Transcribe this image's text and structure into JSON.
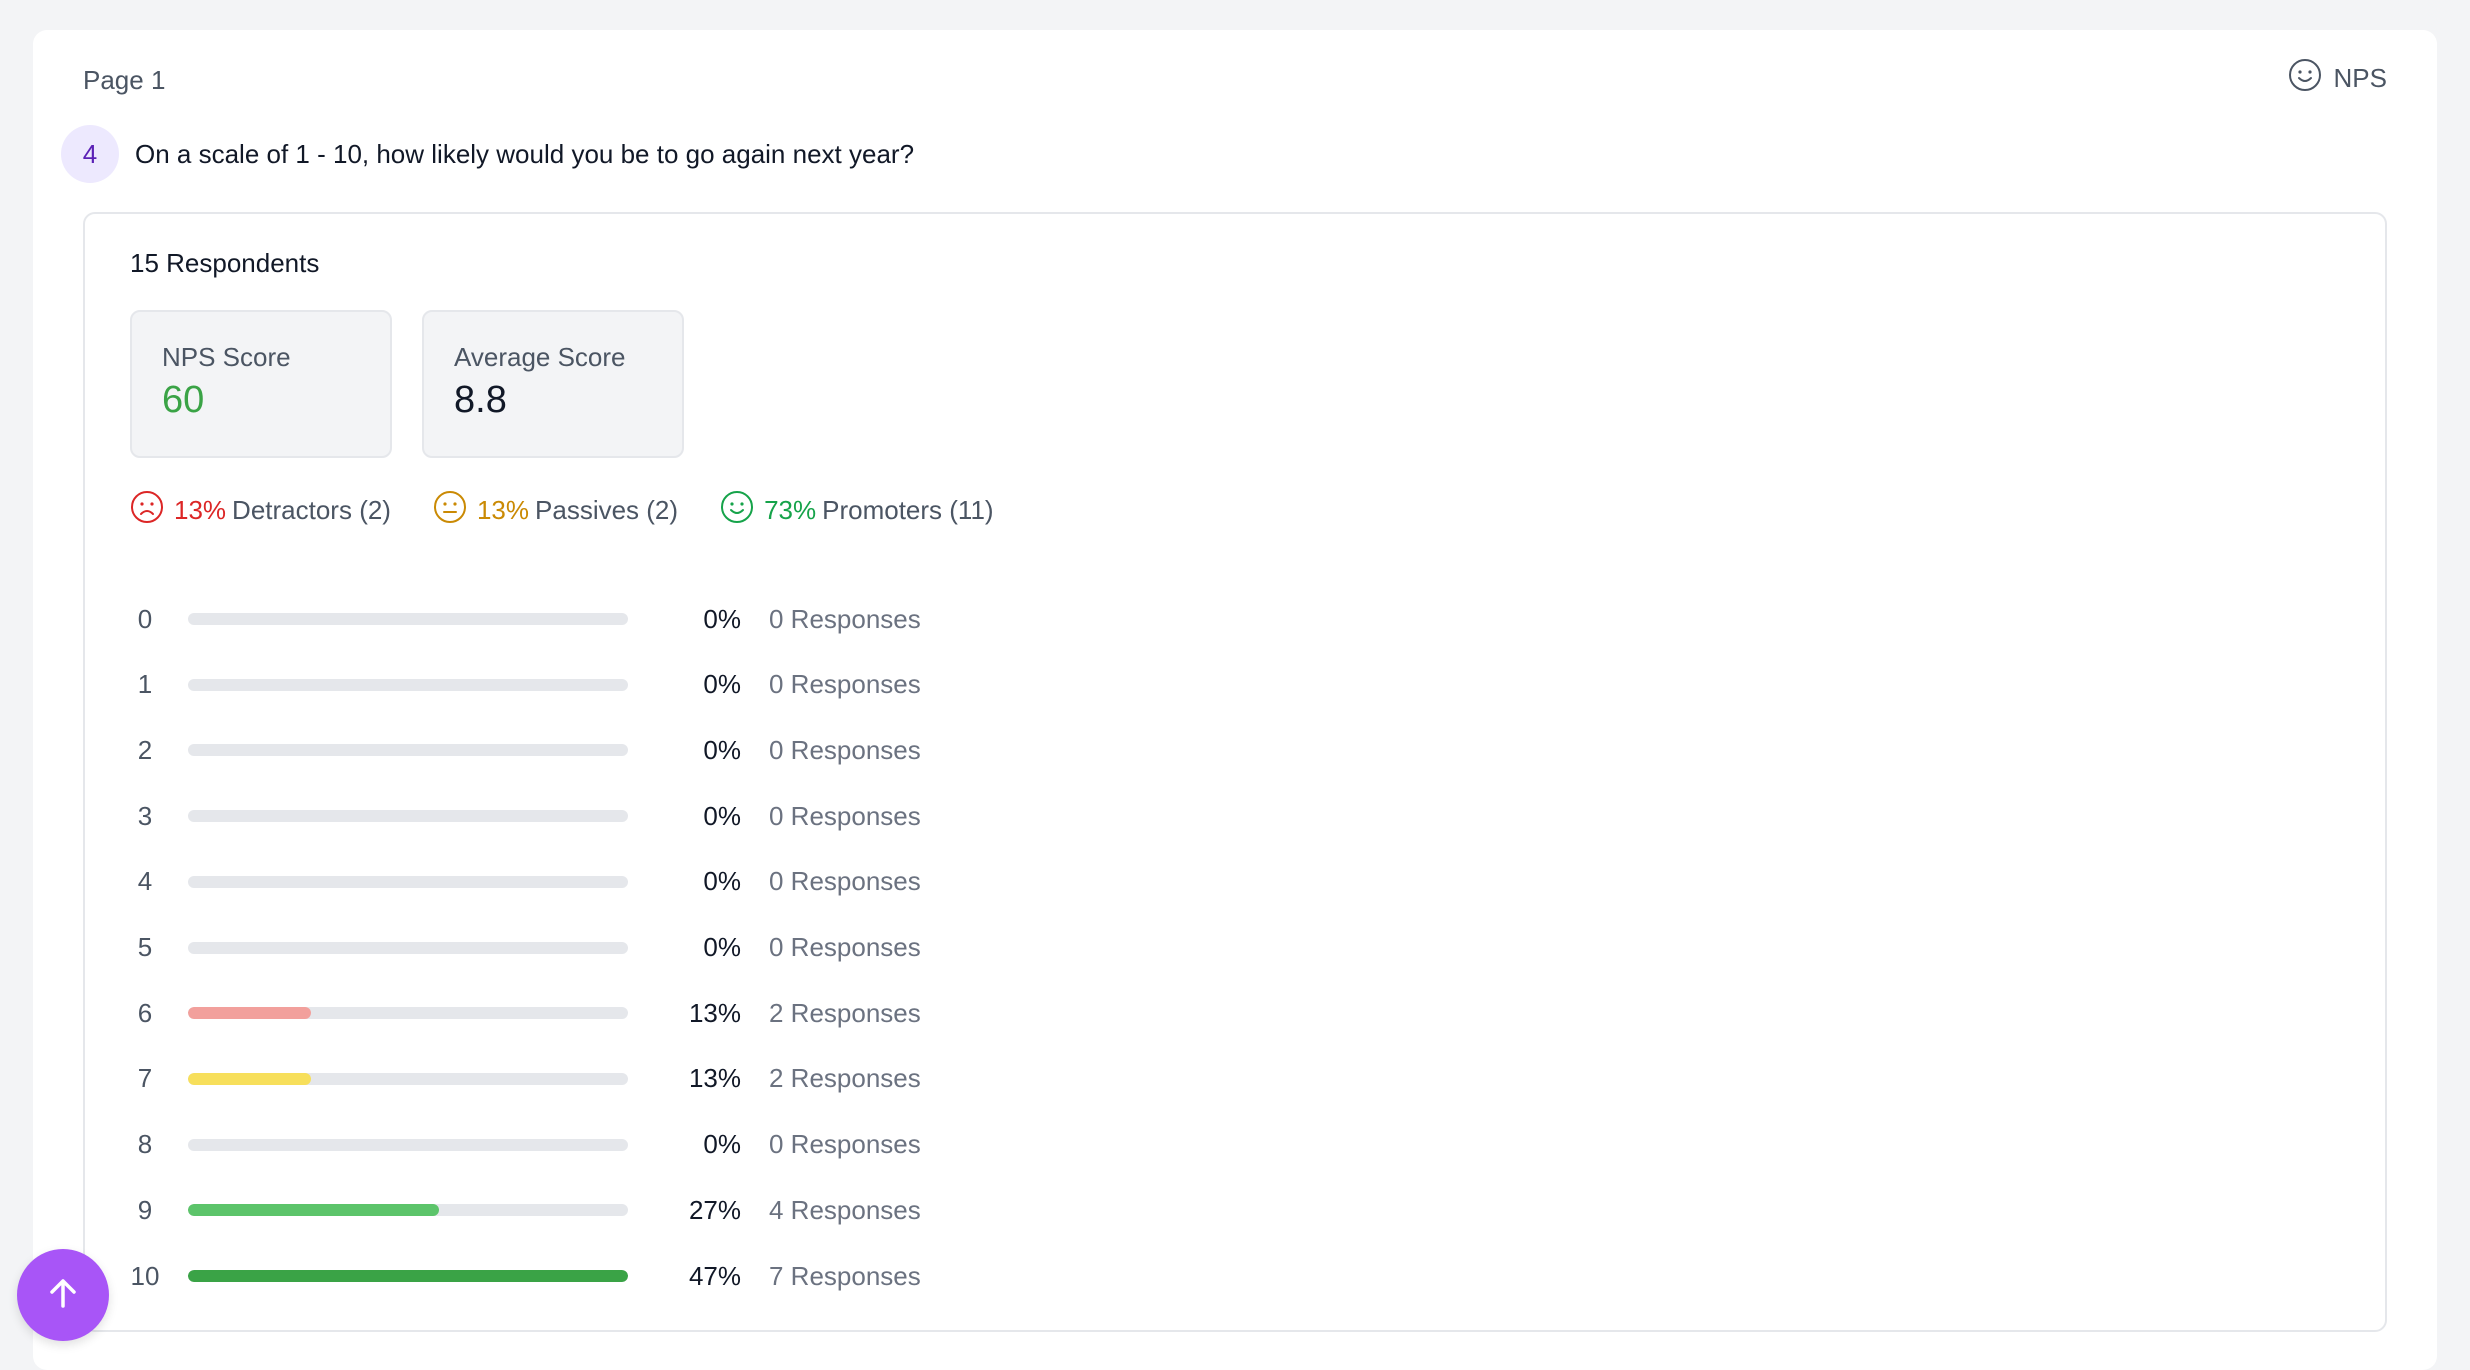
{
  "page_label": "Page 1",
  "question_type": {
    "label": "NPS",
    "icon": "smiley-icon"
  },
  "question": {
    "number": "4",
    "text": "On a scale of 1 - 10, how likely would you be to go again next year?"
  },
  "summary": {
    "respondents": "15 Respondents",
    "nps_score": {
      "label": "NPS Score",
      "value": "60"
    },
    "average_score": {
      "label": "Average Score",
      "value": "8.8"
    }
  },
  "categories": [
    {
      "pct": "13%",
      "label": "Detractors (2)",
      "icon": "frown-icon",
      "color": "#dc2626"
    },
    {
      "pct": "13%",
      "label": "Passives (2)",
      "icon": "neutral-face-icon",
      "color": "#ca8a04"
    },
    {
      "pct": "73%",
      "label": "Promoters (11)",
      "icon": "smile-icon",
      "color": "#16a34a"
    }
  ],
  "distribution": [
    {
      "score": "0",
      "pct": "0%",
      "responses": "0 Responses",
      "fraction": 0,
      "color": "#e5e7eb"
    },
    {
      "score": "1",
      "pct": "0%",
      "responses": "0 Responses",
      "fraction": 0,
      "color": "#e5e7eb"
    },
    {
      "score": "2",
      "pct": "0%",
      "responses": "0 Responses",
      "fraction": 0,
      "color": "#e5e7eb"
    },
    {
      "score": "3",
      "pct": "0%",
      "responses": "0 Responses",
      "fraction": 0,
      "color": "#e5e7eb"
    },
    {
      "score": "4",
      "pct": "0%",
      "responses": "0 Responses",
      "fraction": 0,
      "color": "#e5e7eb"
    },
    {
      "score": "5",
      "pct": "0%",
      "responses": "0 Responses",
      "fraction": 0,
      "color": "#e5e7eb"
    },
    {
      "score": "6",
      "pct": "13%",
      "responses": "2 Responses",
      "fraction": 0.28,
      "color": "#f2a09c"
    },
    {
      "score": "7",
      "pct": "13%",
      "responses": "2 Responses",
      "fraction": 0.28,
      "color": "#f7df5b"
    },
    {
      "score": "8",
      "pct": "0%",
      "responses": "0 Responses",
      "fraction": 0,
      "color": "#e5e7eb"
    },
    {
      "score": "9",
      "pct": "27%",
      "responses": "4 Responses",
      "fraction": 0.57,
      "color": "#5cc46a"
    },
    {
      "score": "10",
      "pct": "47%",
      "responses": "7 Responses",
      "fraction": 1.0,
      "color": "#3aa346"
    }
  ],
  "scroll_top_button": {
    "icon": "arrow-up-icon",
    "color": "#a855f7"
  }
}
